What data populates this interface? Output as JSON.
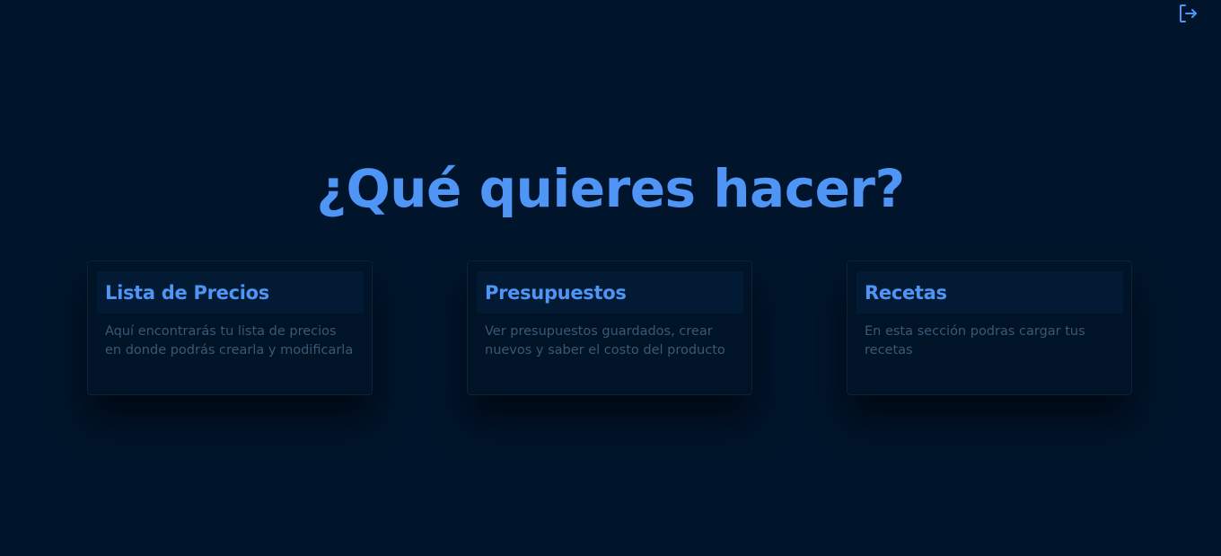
{
  "header": {
    "logout_icon": "logout-icon",
    "accent_color": "#4f95f5"
  },
  "main": {
    "title": "¿Qué quieres hacer?",
    "cards": [
      {
        "title": "Lista de Precios",
        "description": "Aquí encontrarás tu lista de precios en donde podrás crearla y modificarla"
      },
      {
        "title": "Presupuestos",
        "description": "Ver presupuestos guardados, crear nuevos y saber el costo del producto"
      },
      {
        "title": "Recetas",
        "description": "En esta sección podras cargar tus recetas"
      }
    ]
  },
  "colors": {
    "background": "#00152b",
    "accent": "#4f95f5",
    "muted_text": "#3b5873",
    "card_header": "#021a33"
  }
}
